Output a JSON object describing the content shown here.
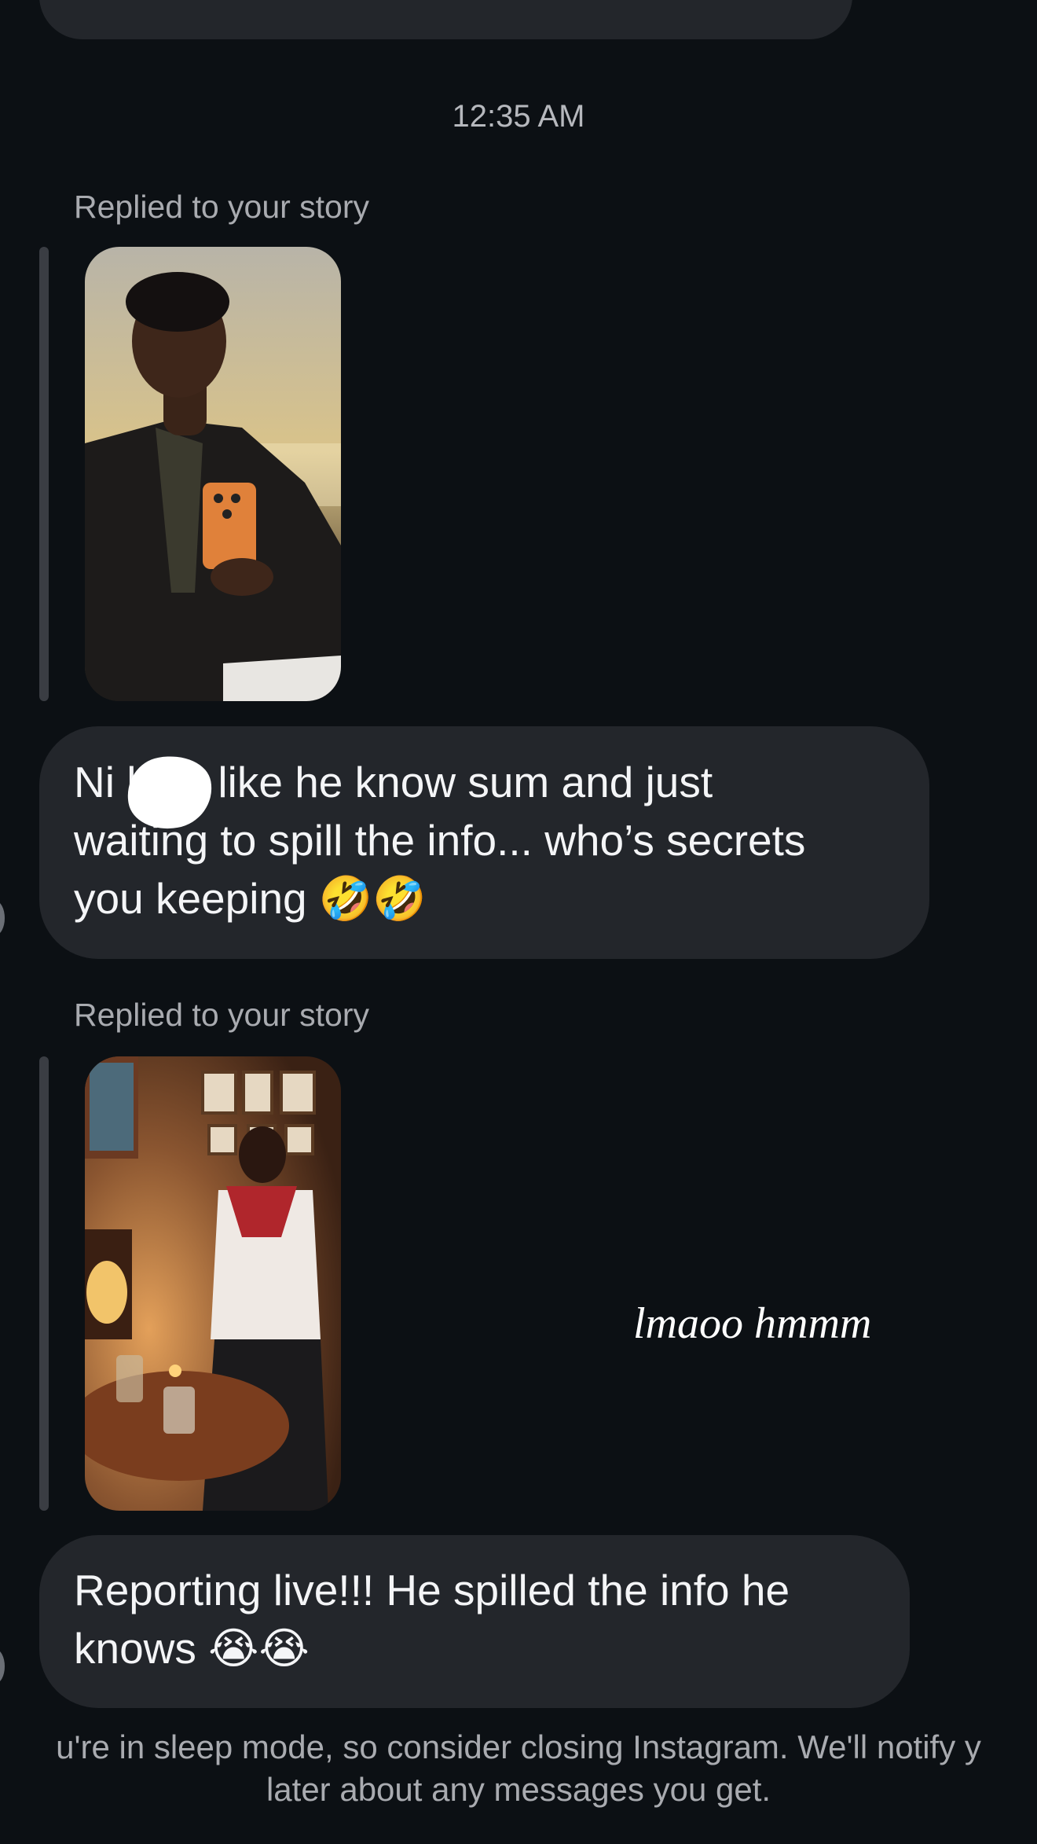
{
  "thread": {
    "timestamp": "12:35 AM",
    "messages": [
      {
        "type": "story_reply",
        "label": "Replied to your story",
        "story_image": "selfie-in-mirror-orange-phone",
        "text": "Ni   look like he know sum and just\nwaiting to spill the info... who’s secrets\nyou keeping 🤣🤣"
      },
      {
        "type": "story_reply",
        "label": "Replied to your story",
        "story_image": "man-laughing-at-bar-table",
        "story_caption": "lmaoo hmmm",
        "text": "Reporting live!!! He spilled the info he\nknows 😭😭"
      }
    ]
  },
  "sleep_notice": {
    "line1": "u're in sleep mode, so consider closing Instagram. We'll notify y",
    "line2": "later about any messages you get."
  },
  "colors": {
    "background": "#0c1014",
    "bubble": "#23262b",
    "secondary_text": "#a9abb0"
  }
}
